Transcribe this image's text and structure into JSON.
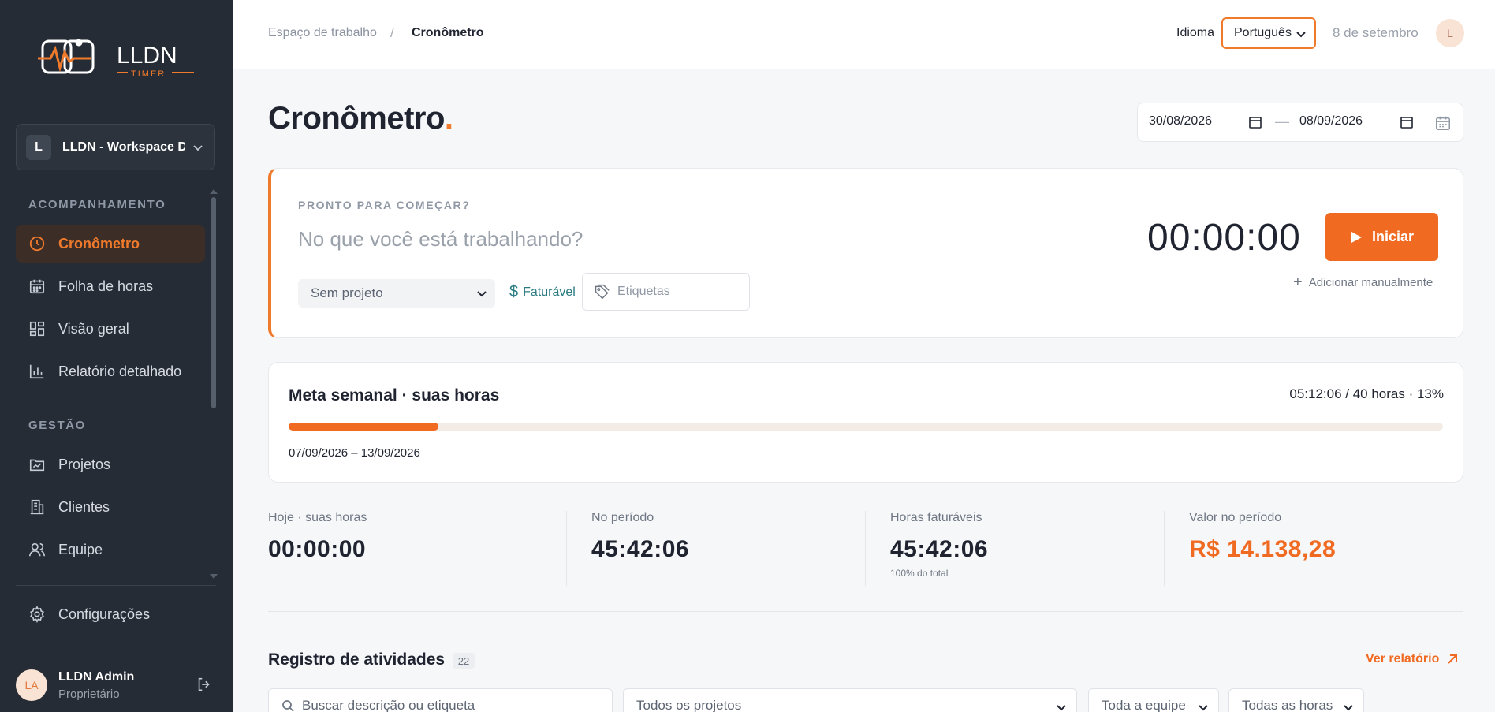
{
  "brand": {
    "name": "LLDN",
    "sub": "TIMER",
    "accent": "#f07a2c"
  },
  "workspace": {
    "initial": "L",
    "name": "LLDN - Workspace De"
  },
  "sidebar": {
    "sections": [
      {
        "title": "ACOMPANHAMENTO"
      },
      {
        "title": "GESTÃO"
      }
    ],
    "items": [
      {
        "label": "Cronômetro",
        "icon": "clock-icon",
        "active": true
      },
      {
        "label": "Folha de horas",
        "icon": "calendar-icon"
      },
      {
        "label": "Visão geral",
        "icon": "grid-icon"
      },
      {
        "label": "Relatório detalhado",
        "icon": "bar-chart-icon"
      },
      {
        "label": "Projetos",
        "icon": "folder-chart-icon"
      },
      {
        "label": "Clientes",
        "icon": "building-icon"
      },
      {
        "label": "Equipe",
        "icon": "users-icon"
      },
      {
        "label": "Configurações",
        "icon": "gear-icon"
      }
    ]
  },
  "user": {
    "initials": "LA",
    "name": "LLDN Admin",
    "role": "Proprietário"
  },
  "topbar": {
    "breadcrumb": [
      "Espaço de trabalho",
      "/",
      "Cronômetro"
    ],
    "language_label": "Idioma",
    "language_value": "Português",
    "date": "8 de setembro",
    "avatar": "L"
  },
  "page": {
    "title": "Cronômetro",
    "title_dot": ".",
    "range_start": "30/08/2026",
    "range_sep": "—",
    "range_end": "08/09/2026"
  },
  "timer": {
    "ready": "PRONTO PARA COMEÇAR?",
    "placeholder": "No que você está trabalhando?",
    "project": "Sem projeto",
    "billable_symbol": "$",
    "billable": "Faturável",
    "tags_placeholder": "Etiquetas",
    "time": "00:00:00",
    "start": "Iniciar",
    "manual_plus": "+",
    "manual": "Adicionar manualmente"
  },
  "goal": {
    "title": "Meta semanal · suas horas",
    "value": "05:12:06 / 40 horas · 13%",
    "progress": 0.13,
    "range": "07/09/2026 – 13/09/2026"
  },
  "stats": [
    {
      "label": "Hoje · suas horas",
      "value": "00:00:00"
    },
    {
      "label": "No período",
      "value": "45:42:06"
    },
    {
      "label": "Horas faturáveis",
      "value": "45:42:06",
      "sub": "100% do total"
    },
    {
      "label": "Valor no período",
      "value": "R$ 14.138,28"
    }
  ],
  "activity": {
    "title": "Registro de atividades",
    "count": "22",
    "report_link": "Ver relatório",
    "search_placeholder": "Buscar descrição ou etiqueta",
    "filters": [
      "Todos os projetos",
      "Toda a equipe",
      "Todas as horas"
    ]
  }
}
